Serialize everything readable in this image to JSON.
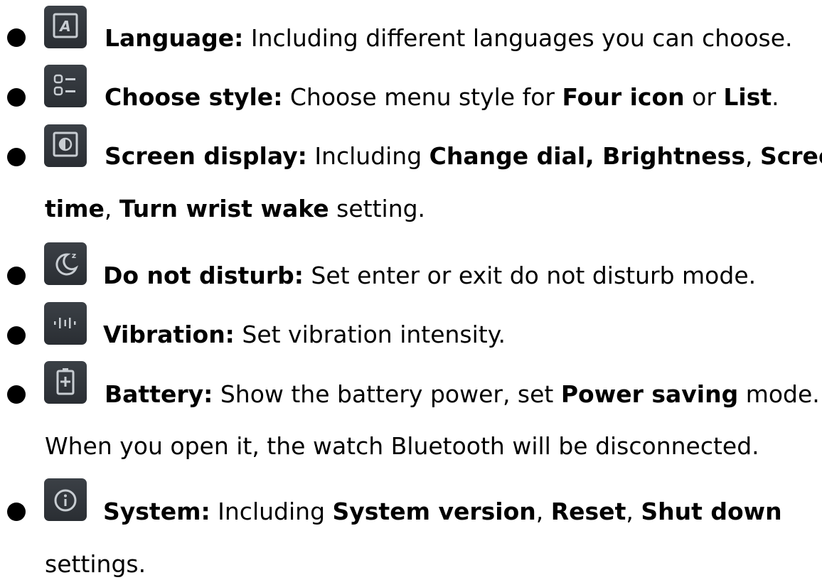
{
  "items": [
    {
      "icon": "language-icon",
      "title": "Language:",
      "line1": [
        " Including different languages you can choose."
      ],
      "line2": []
    },
    {
      "icon": "list-style-icon",
      "title": "Choose style:",
      "t1": " Choose menu style for ",
      "b1": "Four icon",
      "t2": " or ",
      "b2": "List",
      "t3": "."
    },
    {
      "icon": "screen-display-icon",
      "title": "Screen display:",
      "t1": " Including ",
      "b1": "Change dial, Brightness",
      "t2": ", ",
      "b2": "Screen",
      "l2b1": "time",
      "l2t1": ", ",
      "l2b2": "Turn wrist wake",
      "l2t2": " setting."
    },
    {
      "icon": "moon-icon",
      "title": "Do not disturb:",
      "t1": " Set enter or exit do not disturb mode."
    },
    {
      "icon": "vibration-icon",
      "title": "Vibration:",
      "t1": " Set vibration intensity."
    },
    {
      "icon": "battery-icon",
      "title": "Battery:",
      "t1": " Show the battery power, set ",
      "b1": "Power saving",
      "t2": " mode.",
      "line2": "When you open it, the watch Bluetooth will be disconnected."
    },
    {
      "icon": "info-icon",
      "title": "System:",
      "t1": " Including ",
      "b1": "System version",
      "t2": ", ",
      "b2": "Reset",
      "t3": ", ",
      "b3": "Shut down",
      "line2": "settings."
    }
  ]
}
